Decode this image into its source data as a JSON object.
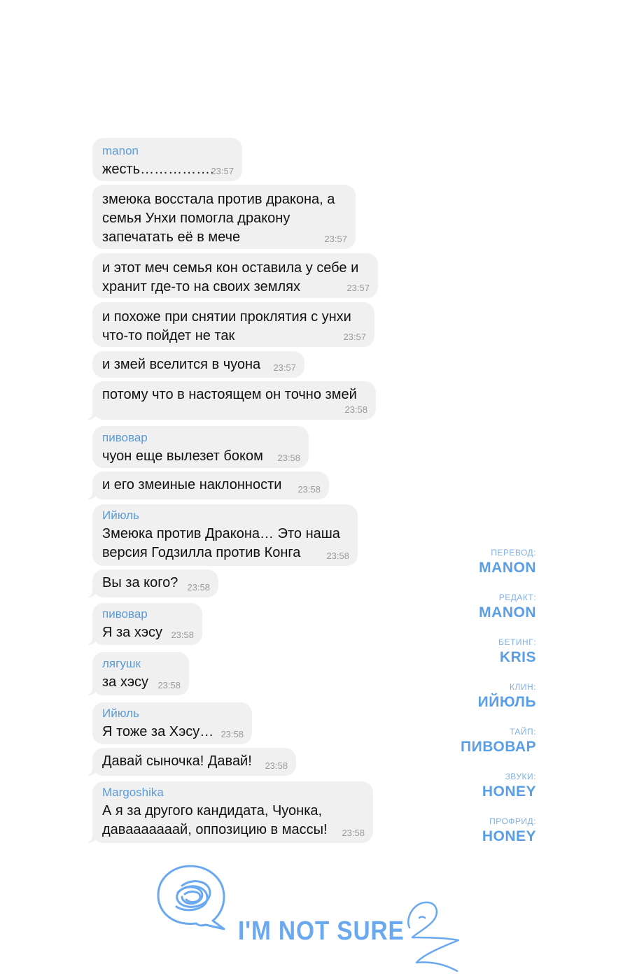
{
  "chat": {
    "messages": [
      {
        "sender": "manon",
        "text": "жесть…………….",
        "time": "23:57"
      },
      {
        "sender": "",
        "text": "змеюка восстала против дракона, а\nсемья Унхи помогла дракону\nзапечатать её в мече",
        "time": "23:57"
      },
      {
        "sender": "",
        "text": "и этот меч семья кон оставила у себе и\nхранит где-то на своих землях",
        "time": "23:57"
      },
      {
        "sender": "",
        "text": "и похоже при снятии проклятия с унхи\nчто-то пойдет не так",
        "time": "23:57"
      },
      {
        "sender": "",
        "text": "и змей вселится в чуона",
        "time": "23:57"
      },
      {
        "sender": "",
        "text": "потому что в настоящем он точно змей",
        "time": "23:58"
      },
      {
        "sender": "пивовар",
        "text": "чуон еще вылезет боком",
        "time": "23:58"
      },
      {
        "sender": "",
        "text": "и его змеиные наклонности",
        "time": "23:58"
      },
      {
        "sender": "Ийюль",
        "text": "Змеюка против Дракона… Это наша\nверсия Годзилла против Конга",
        "time": "23:58"
      },
      {
        "sender": "",
        "text": "Вы за кого?",
        "time": "23:58"
      },
      {
        "sender": "пивовар",
        "text": "Я за хэсу",
        "time": "23:58"
      },
      {
        "sender": "лягушк",
        "text": "за хэсу",
        "time": "23:58"
      },
      {
        "sender": "Ийюль",
        "text": "Я тоже за Хэсу…",
        "time": "23:58"
      },
      {
        "sender": "",
        "text": "Давай сыночка! Давай!",
        "time": "23:58"
      },
      {
        "sender": "Margoshika",
        "text": "А я за другого кандидата, Чуонка,\nдаваааааaай, оппозицию в массы!",
        "time": "23:58"
      }
    ]
  },
  "credits": [
    {
      "label": "ПЕРЕВОД:",
      "name": "MANON"
    },
    {
      "label": "РЕДАКТ:",
      "name": "MANON"
    },
    {
      "label": "БЕТИНГ:",
      "name": "KRIS"
    },
    {
      "label": "КЛИН:",
      "name": "ИЙЮЛЬ"
    },
    {
      "label": "ТАЙП:",
      "name": "ПИВОВАР"
    },
    {
      "label": "ЗВУКИ:",
      "name": "HONEY"
    },
    {
      "label": "ПРОФРИД:",
      "name": "HONEY"
    }
  ],
  "logo": {
    "text": "I'M NOT SURE",
    "icon": "scribble-speech-bubble-icon",
    "color": "#6aa8ef"
  },
  "colors": {
    "bubble": "#f0f0f0",
    "sender": "#5b9bd8",
    "time": "#9a9a9a",
    "credit_name": "#5a9ee6"
  }
}
